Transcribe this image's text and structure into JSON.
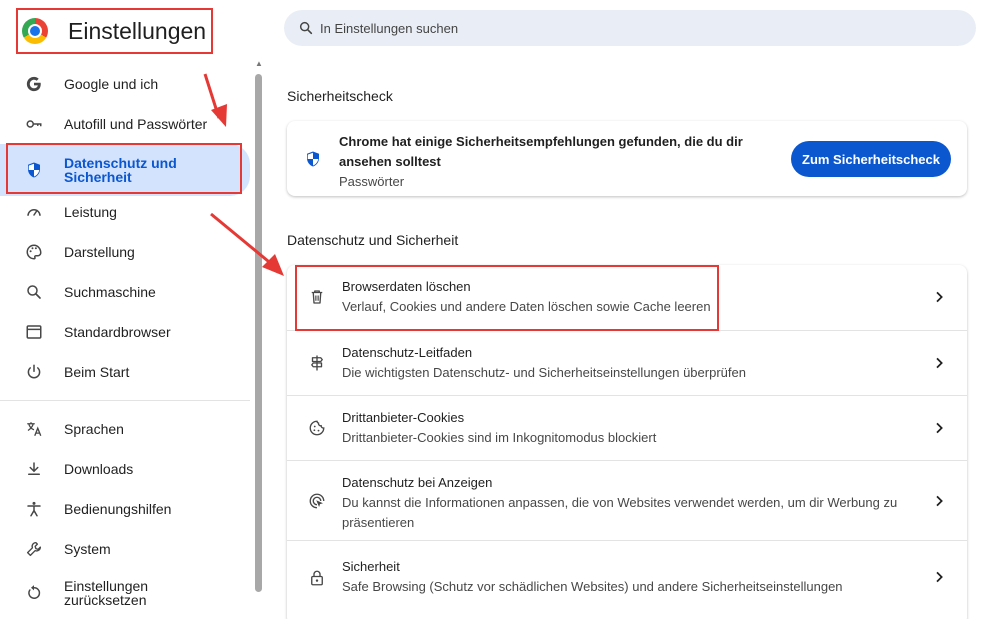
{
  "header": {
    "title": "Einstellungen"
  },
  "search": {
    "placeholder": "In Einstellungen suchen"
  },
  "sidebar": {
    "items": [
      {
        "label": "Google und ich",
        "icon": "google-g-icon"
      },
      {
        "label": "Autofill und Passwörter",
        "icon": "key-icon"
      },
      {
        "label_line1": "Datenschutz und",
        "label_line2": "Sicherheit",
        "icon": "shield-icon",
        "active": true
      },
      {
        "label": "Leistung",
        "icon": "speedometer-icon"
      },
      {
        "label": "Darstellung",
        "icon": "palette-icon"
      },
      {
        "label": "Suchmaschine",
        "icon": "search-icon"
      },
      {
        "label": "Standardbrowser",
        "icon": "browser-window-icon"
      },
      {
        "label": "Beim Start",
        "icon": "power-icon"
      },
      {
        "label": "Sprachen",
        "icon": "translate-icon"
      },
      {
        "label": "Downloads",
        "icon": "download-icon"
      },
      {
        "label": "Bedienungshilfen",
        "icon": "accessibility-icon"
      },
      {
        "label": "System",
        "icon": "wrench-icon"
      },
      {
        "label_line1": "Einstellungen",
        "label_line2": "zurücksetzen",
        "icon": "reset-icon"
      }
    ]
  },
  "main": {
    "safety_check": {
      "section_title": "Sicherheitscheck",
      "line1": "Chrome hat einige Sicherheitsempfehlungen gefunden, die du dir",
      "line2": "ansehen solltest",
      "subtitle": "Passwörter",
      "button_label": "Zum Sicherheitscheck"
    },
    "privacy": {
      "section_title": "Datenschutz und Sicherheit",
      "rows": [
        {
          "title": "Browserdaten löschen",
          "sub": "Verlauf, Cookies und andere Daten löschen sowie Cache leeren",
          "icon": "trash-icon"
        },
        {
          "title": "Datenschutz-Leitfaden",
          "sub": "Die wichtigsten Datenschutz- und Sicherheitseinstellungen überprüfen",
          "icon": "signpost-icon"
        },
        {
          "title": "Drittanbieter-Cookies",
          "sub": "Drittanbieter-Cookies sind im Inkognitomodus blockiert",
          "icon": "cookie-icon"
        },
        {
          "title": "Datenschutz bei Anzeigen",
          "sub_line1": "Du kannst die Informationen anpassen, die von Websites verwendet werden, um dir Werbung zu",
          "sub_line2": "präsentieren",
          "icon": "ad-privacy-icon"
        },
        {
          "title": "Sicherheit",
          "sub": "Safe Browsing (Schutz vor schädlichen Websites) und andere Sicherheitseinstellungen",
          "icon": "lock-icon"
        }
      ]
    }
  },
  "colors": {
    "accent": "#0b57d0",
    "active_bg": "#d3e3fd",
    "annotation_red": "#e53935"
  }
}
